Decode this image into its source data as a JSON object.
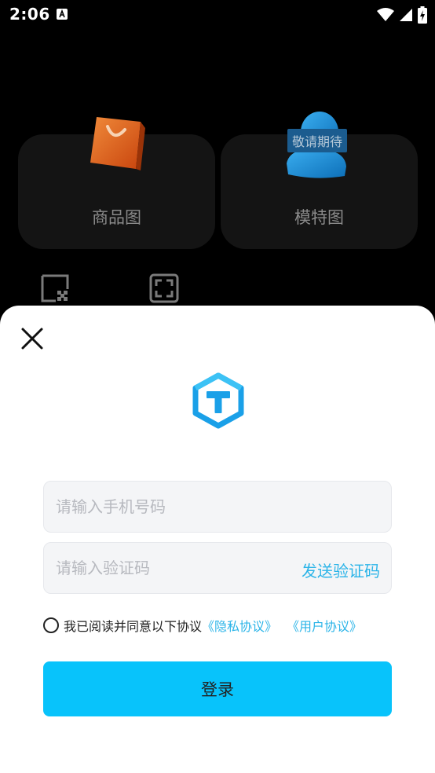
{
  "status_bar": {
    "time": "2:06",
    "icons": [
      "accessibility-a-icon",
      "wifi-icon",
      "cellular-signal-icon",
      "battery-charging-icon"
    ]
  },
  "background": {
    "cards": [
      {
        "label": "商品图",
        "icon": "shopping-bag-3d-icon"
      },
      {
        "label": "模特图",
        "icon": "model-person-3d-icon",
        "badge": "敬请期待"
      }
    ],
    "tools": [
      "transparent-background-icon",
      "fullscreen-frame-icon"
    ]
  },
  "login_sheet": {
    "close_icon": "close-icon",
    "logo_icon": "hexagon-t-logo-icon",
    "phone_input": {
      "placeholder": "请输入手机号码",
      "value": ""
    },
    "code_input": {
      "placeholder": "请输入验证码",
      "value": ""
    },
    "send_code_label": "发送验证码",
    "agreement": {
      "checked": false,
      "text": "我已阅读并同意以下协议",
      "privacy_link": "《隐私协议》",
      "user_link": "《用户协议》"
    },
    "login_button": "登录"
  },
  "colors": {
    "accent": "#08c3fb",
    "link": "#2bb4e8",
    "logo_blue": "#1aa0e8",
    "bag_orange": "#e4661d",
    "badge_bg": "#1b5c8f"
  }
}
